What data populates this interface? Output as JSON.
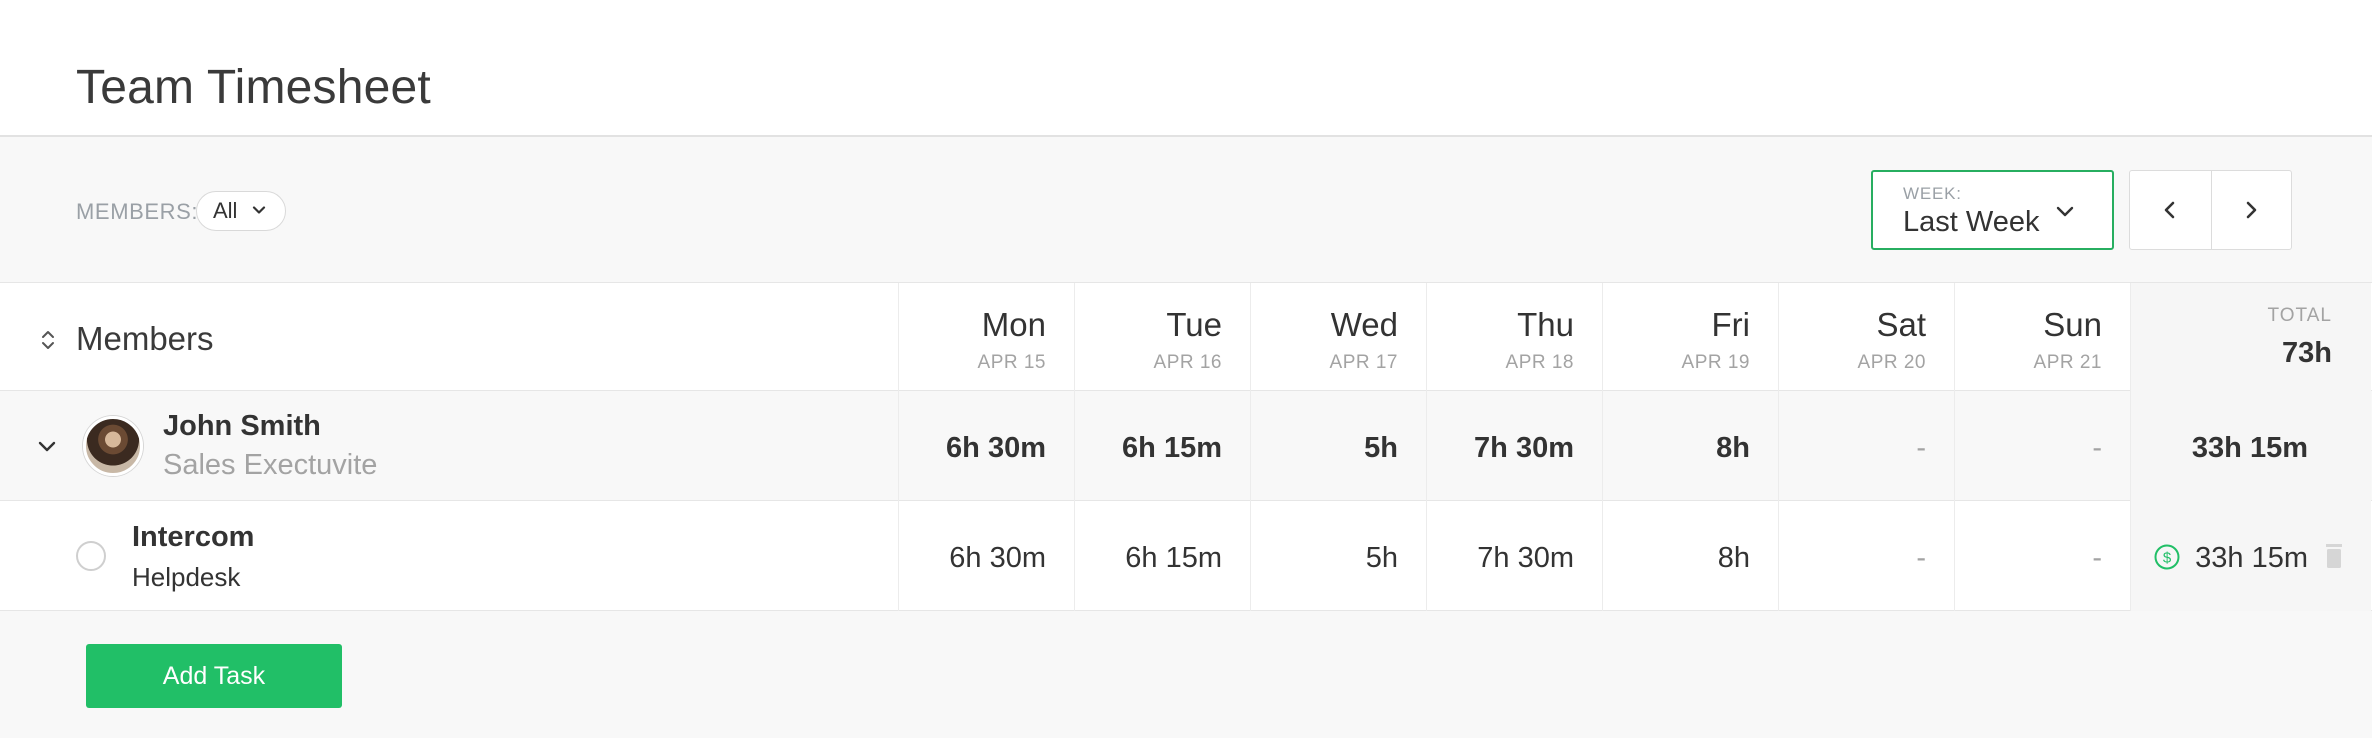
{
  "page": {
    "title": "Team Timesheet"
  },
  "toolbar": {
    "members_label": "MEMBERS:",
    "members_value": "All",
    "week_label": "WEEK:",
    "week_value": "Last Week"
  },
  "grid": {
    "members_heading": "Members",
    "days": [
      {
        "name": "Mon",
        "date": "APR 15"
      },
      {
        "name": "Tue",
        "date": "APR 16"
      },
      {
        "name": "Wed",
        "date": "APR 17"
      },
      {
        "name": "Thu",
        "date": "APR 18"
      },
      {
        "name": "Fri",
        "date": "APR 19"
      },
      {
        "name": "Sat",
        "date": "APR 20"
      },
      {
        "name": "Sun",
        "date": "APR 21"
      }
    ],
    "total_label": "TOTAL",
    "total_value": "73h"
  },
  "member": {
    "name": "John Smith",
    "role": "Sales Exectuvite",
    "hours": [
      "6h 30m",
      "6h 15m",
      "5h",
      "7h 30m",
      "8h",
      "-",
      "-"
    ],
    "total": "33h 15m"
  },
  "task": {
    "project": "Intercom",
    "name": "Helpdesk",
    "hours": [
      "6h 30m",
      "6h 15m",
      "5h",
      "7h 30m",
      "8h",
      "-",
      "-"
    ],
    "total": "33h 15m"
  },
  "actions": {
    "add_task": "Add Task"
  },
  "colors": {
    "accent": "#21bf67",
    "border_accent": "#27ae60",
    "muted": "#a3a3a3"
  },
  "icons": [
    "chevron-down-icon",
    "chevron-left-icon",
    "chevron-right-icon",
    "sort-icon",
    "dollar-icon",
    "trash-icon"
  ]
}
